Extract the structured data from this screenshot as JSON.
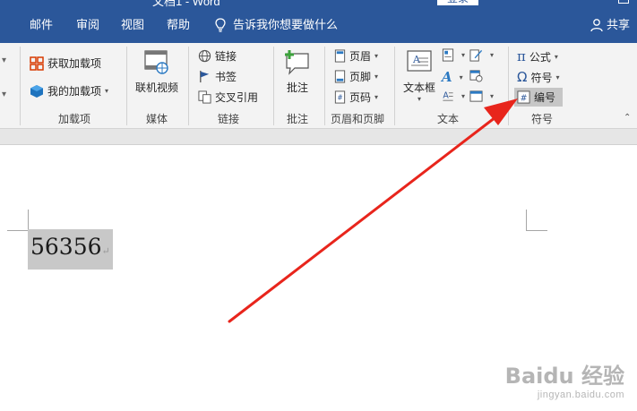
{
  "titlebar": {
    "title": "文档1 - Word",
    "login": "登录"
  },
  "menu": {
    "tabs": [
      "邮件",
      "审阅",
      "视图",
      "帮助"
    ],
    "tell_me": "告诉我你想要做什么",
    "share": "共享"
  },
  "ribbon": {
    "addins": {
      "get": "获取加载项",
      "my": "我的加载项",
      "label": "加载项"
    },
    "media": {
      "online_video": "联机视频",
      "label": "媒体"
    },
    "links": {
      "link": "链接",
      "bookmark": "书签",
      "cross_ref": "交叉引用",
      "label": "链接"
    },
    "comments": {
      "comment": "批注",
      "label": "批注"
    },
    "header_footer": {
      "header": "页眉",
      "footer": "页脚",
      "page_number": "页码",
      "label": "页眉和页脚"
    },
    "text": {
      "textbox": "文本框",
      "label": "文本"
    },
    "symbols": {
      "equation": "公式",
      "symbol": "符号",
      "number": "编号",
      "label": "符号"
    }
  },
  "document": {
    "text": "56356"
  },
  "watermark": {
    "logo": "Baidu 经验",
    "url": "jingyan.baidu.com"
  },
  "colors": {
    "accent": "#2b579a",
    "arrow": "#e8251c",
    "selection": "#c8c8c8"
  }
}
